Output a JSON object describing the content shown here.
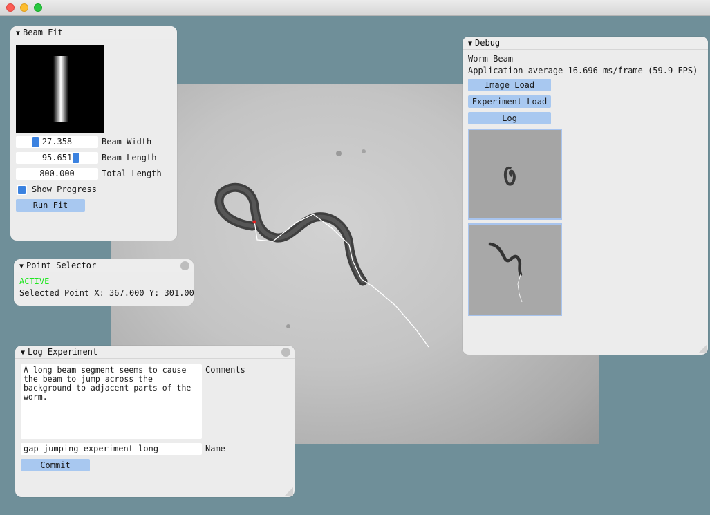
{
  "colors": {
    "background": "#6f8f99",
    "panel": "#ececec",
    "button": "#a8c8f0",
    "accent": "#3b82e0",
    "active_text": "#22e622",
    "trace": "#ffffff"
  },
  "beam_fit": {
    "title": "Beam Fit",
    "beam_width": {
      "value": "27.358",
      "label": "Beam Width",
      "fraction": 0.08
    },
    "beam_length": {
      "value": "95.651",
      "label": "Beam Length",
      "fraction": 0.72
    },
    "total_length": {
      "value": "800.000",
      "label": "Total Length"
    },
    "show_progress": {
      "label": "Show Progress",
      "checked": true
    },
    "run_fit": "Run Fit"
  },
  "point_selector": {
    "title": "Point Selector",
    "status": "ACTIVE",
    "selected_point": "Selected Point X: 367.000  Y: 301.00"
  },
  "log_experiment": {
    "title": "Log Experiment",
    "comments_value": "A long beam segment seems to cause\nthe beam to jump across the\nbackground to adjacent parts of the\nworm.",
    "comments_label": "Comments",
    "name_value": "gap-jumping-experiment-long",
    "name_label": "Name",
    "commit": "Commit"
  },
  "debug": {
    "title": "Debug",
    "app_name": "Worm Beam",
    "fps_text": "Application average 16.696 ms/frame (59.9 FPS)",
    "buttons": [
      "Image Load",
      "Experiment Load",
      "Log"
    ],
    "thumbnails": [
      "curled-worm-thumbnail",
      "wavy-worm-thumbnail"
    ]
  }
}
